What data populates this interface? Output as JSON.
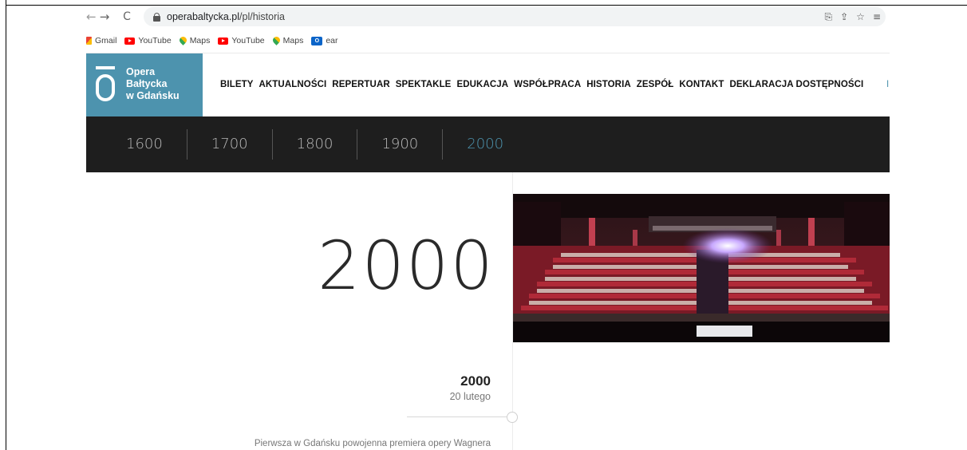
{
  "browser": {
    "back_glyph": "←",
    "forward_glyph": "→",
    "reload_glyph": "C",
    "url_host": "operabaltycka.pl",
    "url_path": "/pl/historia",
    "icons": [
      "translate-icon",
      "share-icon",
      "star-icon",
      "reading-list-icon"
    ]
  },
  "bookmarks": [
    {
      "label": "Gmail",
      "icon": "gmail-icon"
    },
    {
      "label": "YouTube",
      "icon": "youtube-icon"
    },
    {
      "label": "Maps",
      "icon": "maps-icon"
    },
    {
      "label": "YouTube",
      "icon": "youtube-icon"
    },
    {
      "label": "Maps",
      "icon": "maps-icon"
    },
    {
      "label": "ear",
      "icon": "outlook-icon"
    }
  ],
  "logo": {
    "line1": "Opera",
    "line2": "Bałtycka",
    "line3": "w Gdańsku",
    "color": "#4d93ae"
  },
  "nav": {
    "items": [
      "BILETY",
      "AKTUALNOŚCI",
      "REPERTUAR",
      "SPEKTAKLE",
      "EDUKACJA",
      "WSPÓŁPRACA",
      "HISTORIA",
      "ZESPÓŁ",
      "KONTAKT",
      "DEKLARACJA DOSTĘPNOŚCI"
    ],
    "extra": "I"
  },
  "years": {
    "items": [
      "1600",
      "1700",
      "1800",
      "1900",
      "2000"
    ],
    "active": "2000",
    "active_color": "#4d93ae"
  },
  "main": {
    "big_year": "2000"
  },
  "entry": {
    "year": "2000",
    "date": "20 lutego",
    "text": "Pierwsza w Gdańsku powojenna premiera opery Wagnera"
  }
}
